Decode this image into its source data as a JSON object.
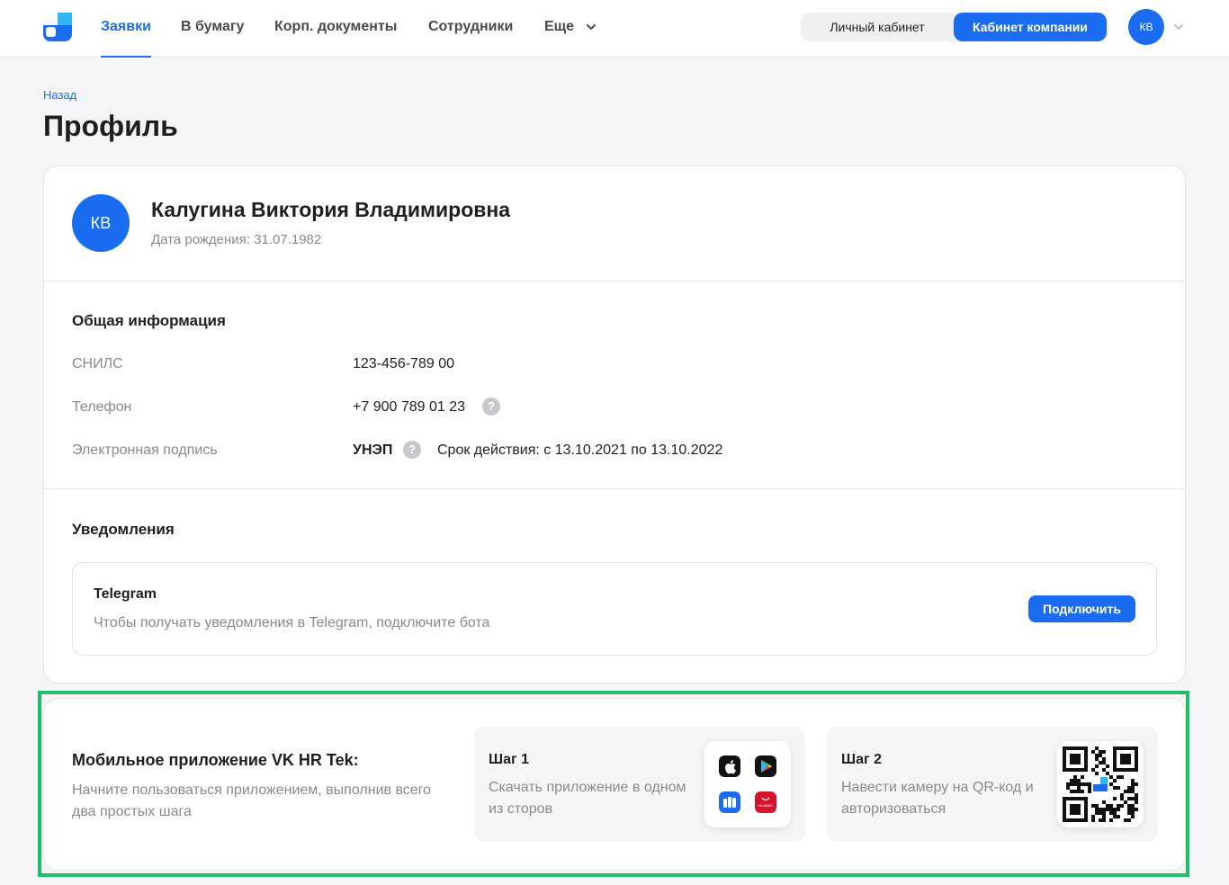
{
  "header": {
    "nav": [
      {
        "label": "Заявки",
        "active": true
      },
      {
        "label": "В бумагу",
        "active": false
      },
      {
        "label": "Корп. документы",
        "active": false
      },
      {
        "label": "Сотрудники",
        "active": false
      },
      {
        "label": "Еще",
        "active": false
      }
    ],
    "switch": {
      "personal": "Личный кабинет",
      "company": "Кабинет компании",
      "selected": "company"
    },
    "avatar_initials": "КВ"
  },
  "breadcrumb": {
    "back": "Назад"
  },
  "page": {
    "title": "Профиль"
  },
  "profile": {
    "initials": "КВ",
    "name": "Калугина Виктория Владимировна",
    "birth": "Дата рождения: 31.07.1982"
  },
  "general": {
    "title": "Общая информация",
    "snils_label": "СНИЛС",
    "snils_value": "123-456-789 00",
    "phone_label": "Телефон",
    "phone_value": "+7 900 789 01 23",
    "esign_label": "Электронная подпись",
    "esign_type": "УНЭП",
    "esign_validity": "Срок действия: с 13.10.2021 по 13.10.2022"
  },
  "notifications": {
    "title": "Уведомления",
    "telegram": {
      "title": "Telegram",
      "desc": "Чтобы получать уведомления в Telegram, подключите бота",
      "button": "Подключить"
    }
  },
  "mobile": {
    "title": "Мобильное приложение VK HR Tek:",
    "desc": "Начните пользоваться приложением, выполнив всего два простых шага",
    "step1": {
      "title": "Шаг 1",
      "desc": "Скачать приложение в одном из сторов"
    },
    "step2": {
      "title": "Шаг 2",
      "desc": "Навести камеру на QR-код и авторизоваться"
    },
    "stores": [
      "app-store-icon",
      "google-play-icon",
      "rustore-icon",
      "appgallery-icon"
    ],
    "store_badge_text": "HUAWEI"
  },
  "colors": {
    "accent": "#1a6cf0",
    "highlight": "#1dbf6a"
  }
}
